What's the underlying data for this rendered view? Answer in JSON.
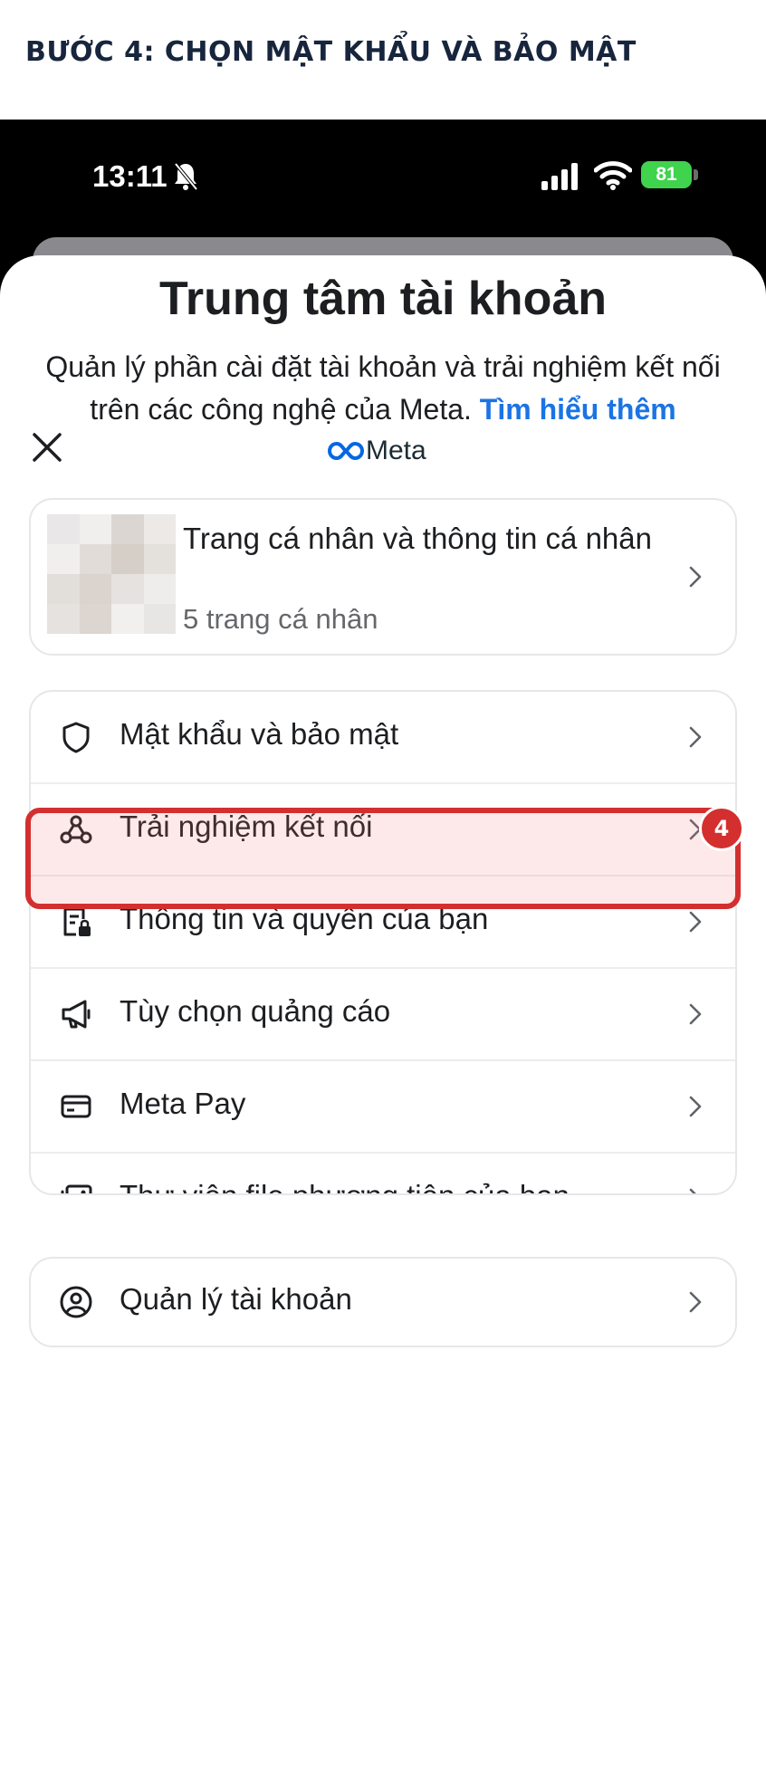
{
  "step_heading": "BƯỚC 4: CHỌN MẬT KHẨU VÀ BẢO MẬT",
  "status_bar": {
    "time": "13:11",
    "battery": "81"
  },
  "header": {
    "brand": "Meta"
  },
  "title": "Trung tâm tài khoản",
  "description": "Quản lý phần cài đặt tài khoản và trải nghiệm kết nối trên các công nghệ của Meta.",
  "learn_more": "Tìm hiểu thêm",
  "profile_card": {
    "title": "Trang cá nhân và thông tin cá nhân",
    "subtitle": "5 trang cá nhân"
  },
  "menu": {
    "items": [
      {
        "label": "Mật khẩu và bảo mật",
        "icon": "shield-icon"
      },
      {
        "label": "Trải nghiệm kết nối",
        "icon": "connected-nodes-icon"
      },
      {
        "label": "Thông tin và quyền của bạn",
        "icon": "document-lock-icon"
      },
      {
        "label": "Tùy chọn quảng cáo",
        "icon": "megaphone-icon"
      },
      {
        "label": "Meta Pay",
        "icon": "card-icon"
      },
      {
        "label": "Thư viện file phương tiện của bạn",
        "icon": "media-library-icon"
      }
    ]
  },
  "account_item": {
    "label": "Quản lý tài khoản",
    "icon": "person-circle-icon"
  },
  "step_badge": "4",
  "colors": {
    "link": "#1b74e4",
    "highlight": "#d32f2f",
    "battery": "#3fd34e"
  }
}
